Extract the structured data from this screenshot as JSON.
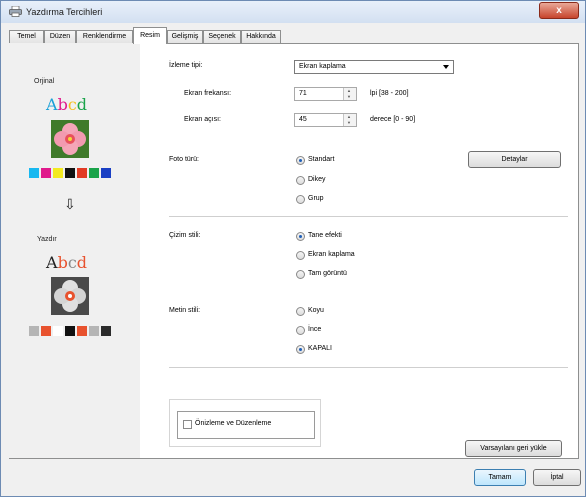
{
  "window": {
    "title": "Yazdırma Tercihleri",
    "close_label": "x"
  },
  "tabs": [
    {
      "label": "Temel"
    },
    {
      "label": "Düzen"
    },
    {
      "label": "Renklendirme"
    },
    {
      "label": "Resim",
      "active": true
    },
    {
      "label": "Gelişmiş"
    },
    {
      "label": "Seçenek"
    },
    {
      "label": "Hakkında"
    }
  ],
  "preview": {
    "original_label": "Orjinal",
    "print_label": "Yazdır",
    "sample_text": "Abcd",
    "arrow": "⇩",
    "original_swatches": [
      "#18b8f0",
      "#e01a8c",
      "#f3ea20",
      "#111111",
      "#e23b24",
      "#1aa34a",
      "#1a3fc4"
    ],
    "print_swatches": [
      "#b5b5b5",
      "#e8522e",
      "#ffffff",
      "#111111",
      "#e8522e",
      "#b5b5b5",
      "#2b2b2b"
    ]
  },
  "screening": {
    "label": "İzleme tipi:",
    "selected": "Ekran kaplama",
    "frequency": {
      "label": "Ekran frekansı:",
      "value": "71",
      "range": "lpi [38 - 200]"
    },
    "angle": {
      "label": "Ekran açısı:",
      "value": "45",
      "range": "derece [0 - 90]"
    }
  },
  "photo": {
    "label": "Foto türü:",
    "options": [
      "Standart",
      "Dikey",
      "Grup"
    ],
    "selected": 0,
    "details_button": "Detaylar"
  },
  "drawing": {
    "label": "Çizim stili:",
    "options": [
      "Tane efekti",
      "Ekran kaplama",
      "Tam görüntü"
    ],
    "selected": 0
  },
  "text_style": {
    "label": "Metin stili:",
    "options": [
      "Koyu",
      "İnce",
      "KAPALI"
    ],
    "selected": 2
  },
  "preview_edit": {
    "label": "Önizleme ve Düzenleme",
    "checked": false
  },
  "buttons": {
    "restore_defaults": "Varsayılanı geri yükle",
    "ok": "Tamam",
    "cancel": "İptal"
  }
}
